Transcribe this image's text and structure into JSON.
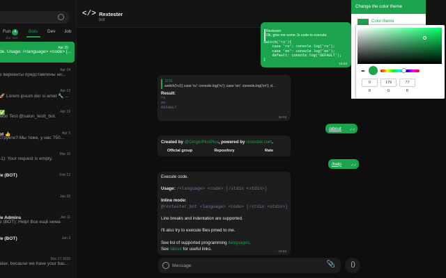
{
  "sidebar": {
    "folders": [
      {
        "label": "Fun",
        "badge": "4"
      },
      {
        "label": "Bots"
      },
      {
        "label": "Dev"
      },
      {
        "label": "Job"
      }
    ],
    "peek_snippet": "@p_rpjj]",
    "chats": [
      {
        "name": "",
        "snippet": "de. Usage: /<language> <code> [...",
        "date": "Apr 25",
        "active": true
      },
      {
        "name": "",
        "snippet": "е варианты представлены ни...",
        "date": "Apr 24"
      },
      {
        "name": "",
        "snippet": "🚀 Lorem ipsum dor si amet 🔧 ...",
        "date": "Apr 19"
      },
      {
        "name": "✅",
        "snippet": "alon Test @salon_testt_bot.",
        "date": "Apr 19"
      },
      {
        "name": "ot 👍",
        "snippet": "струете? Мы тоже, у нас 750...",
        "date": "Apr 5"
      },
      {
        "name": "",
        "snippet": "-1): Your request is empty.",
        "date": "Mar 16"
      },
      {
        "name": "le (BOT)",
        "snippet": "",
        "date": "Feb 13"
      },
      {
        "name": "",
        "snippet": "",
        "date": "Jan 28"
      },
      {
        "name": "le Admins",
        "snippet": "e (BOT): Help! Все ещё нема",
        "date": "Jan 11"
      },
      {
        "name": "le (BOT)",
        "snippet": "",
        "date": "Jan 3"
      },
      {
        "name": "",
        "snippet": "alax, because we have your bac...",
        "date": "Dec 27 2020"
      }
    ]
  },
  "chat": {
    "title": "Rextester",
    "status": "bot"
  },
  "messages": {
    "out_code": {
      "quote_author": "Rextester",
      "quote_text": "Ok, give me some Js code to execute",
      "code": "switch('ru'){\n    case 'ru': console.log('ru');\n    case 'en': console.log('en');\n    default: console.log('DEFAULT');\n}",
      "time": "16:03"
    },
    "code_reply": {
      "quote_author": "JZJS",
      "quote_text": "switch('ru'){ case 'ru': console.log('ru'); case 'en': console.log('en'); d...",
      "result_label": "Result:",
      "result_lines": [
        "ru",
        "en",
        "DEFAULT"
      ],
      "time": "16:03"
    },
    "out_about": {
      "text": "/about",
      "time": "16:03"
    },
    "about_card": {
      "prefix": "Created by ",
      "author": "@GingerPlusPlus",
      "middle": ", powered by ",
      "site": "rextester.com",
      "suffix": ".",
      "buttons": [
        "Official group",
        "Repository",
        "Rate"
      ]
    },
    "out_help": {
      "text": "/help",
      "time": "16:03"
    },
    "help_card": {
      "l1": "Execute code.",
      "usage_label": "Usage:",
      "usage_code": "/<language> <code> [/stdin <stdin>]",
      "inline_label": "Inline mode:",
      "inline_code": "@rextester_bot <language> <code> [/stdin <stdin>]",
      "l4": "Line breaks and indentation are supported.",
      "l5": "I'll also try to execute files pmed to me.",
      "l6a": "See list of supported programming ",
      "l6b": "/languages",
      "l6c": ".",
      "l7a": "See ",
      "l7b": "/about",
      "l7c": " for useful links.",
      "time": "16:03"
    }
  },
  "composer": {
    "placeholder": "Message"
  },
  "theme_panel": {
    "header": "Change the color theme",
    "label": "Color theme",
    "accent": "#1ba34e",
    "rgb": {
      "r": "0",
      "g": "179",
      "b": "77"
    },
    "rgb_labels": [
      "R",
      "G",
      "B"
    ]
  }
}
